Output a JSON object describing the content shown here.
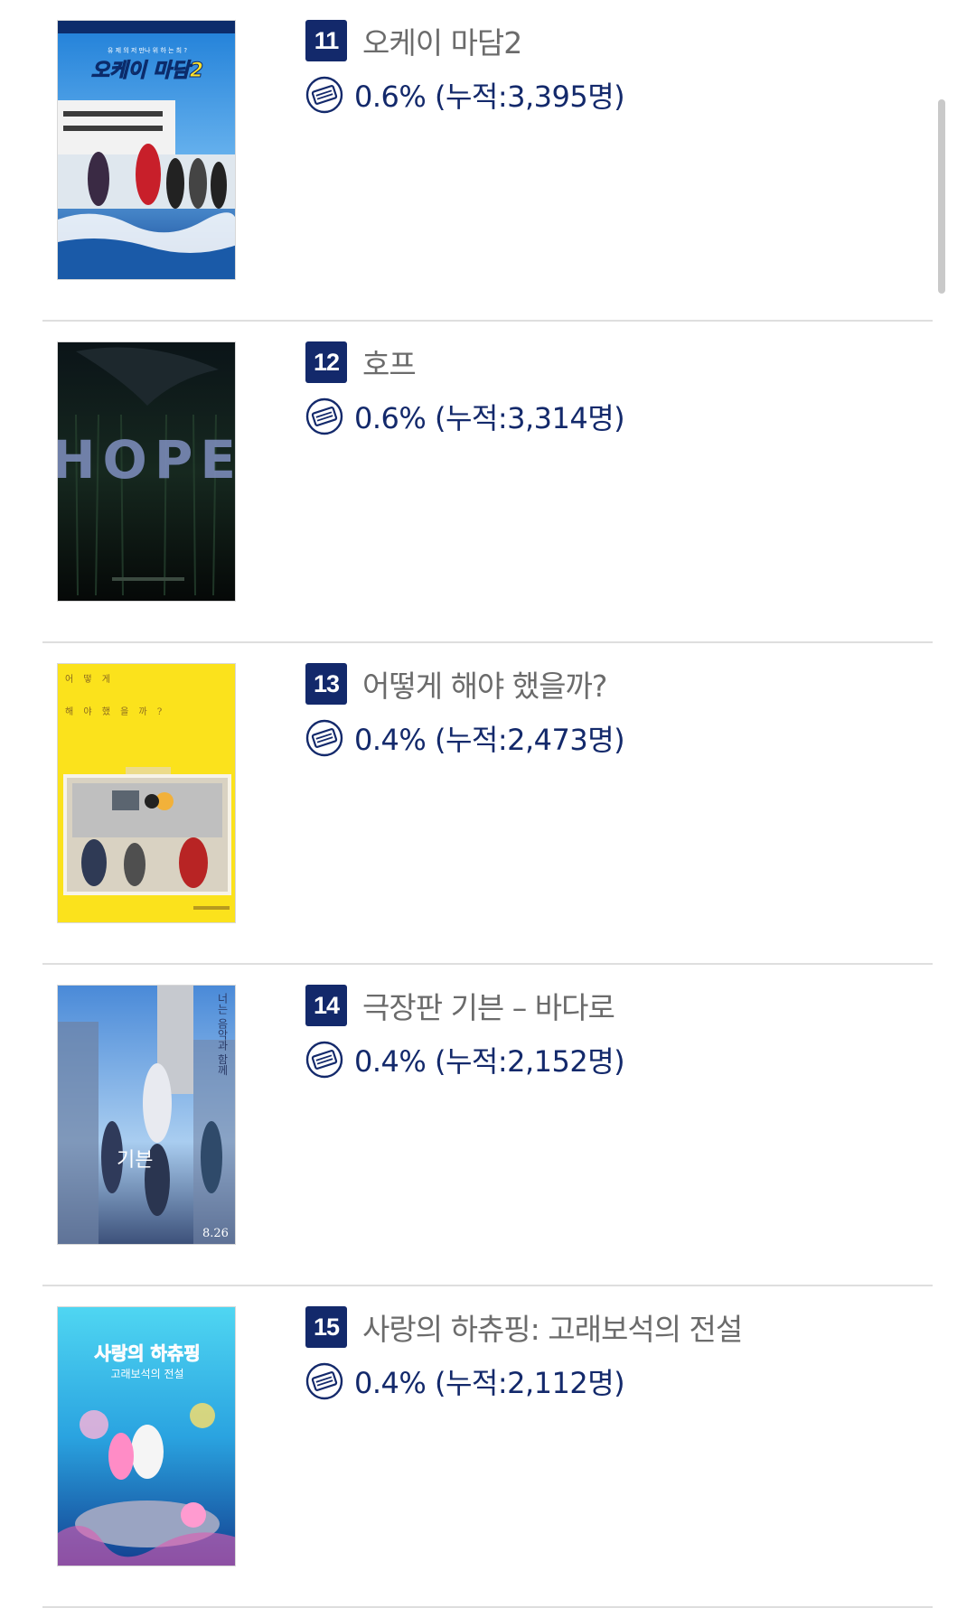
{
  "movies": [
    {
      "rank": "11",
      "title": "오케이 마담2",
      "stat": "0.6% (누적:3,395명)",
      "poster": {
        "icon": "poster-ok-madam-2",
        "tagline": "유 제 의 저 만나 위 하 는 최 ?",
        "logo": "오케이 마담2"
      }
    },
    {
      "rank": "12",
      "title": "호프",
      "stat": "0.6% (누적:3,314명)",
      "poster": {
        "icon": "poster-hope",
        "logo": "HOPE"
      }
    },
    {
      "rank": "13",
      "title": "어떻게 해야 했을까?",
      "stat": "0.4% (누적:2,473명)",
      "poster": {
        "icon": "poster-what-should-we-have-done",
        "line1": "어 떻 게",
        "line2": "해 야 했 을 까 ?"
      }
    },
    {
      "rank": "14",
      "title": "극장판 기븐 – 바다로",
      "stat": "0.4% (누적:2,152명)",
      "poster": {
        "icon": "poster-given-to-the-sea",
        "vertical_text": "너는 음악과 함께",
        "logo": "기븐",
        "date": "8.26"
      }
    },
    {
      "rank": "15",
      "title": "사랑의 하츄핑: 고래보석의 전설",
      "stat": "0.4% (누적:2,112명)",
      "poster": {
        "icon": "poster-catch-teenieping",
        "logo": "사랑의 하츄핑",
        "subtitle": "고래보석의 전설"
      }
    }
  ],
  "icons": {
    "ticket": "ticket-icon"
  },
  "colors": {
    "rank_bg": "#13296b",
    "stat_text": "#13296b",
    "title_text": "#6b6b6b",
    "divider": "#dedede"
  }
}
